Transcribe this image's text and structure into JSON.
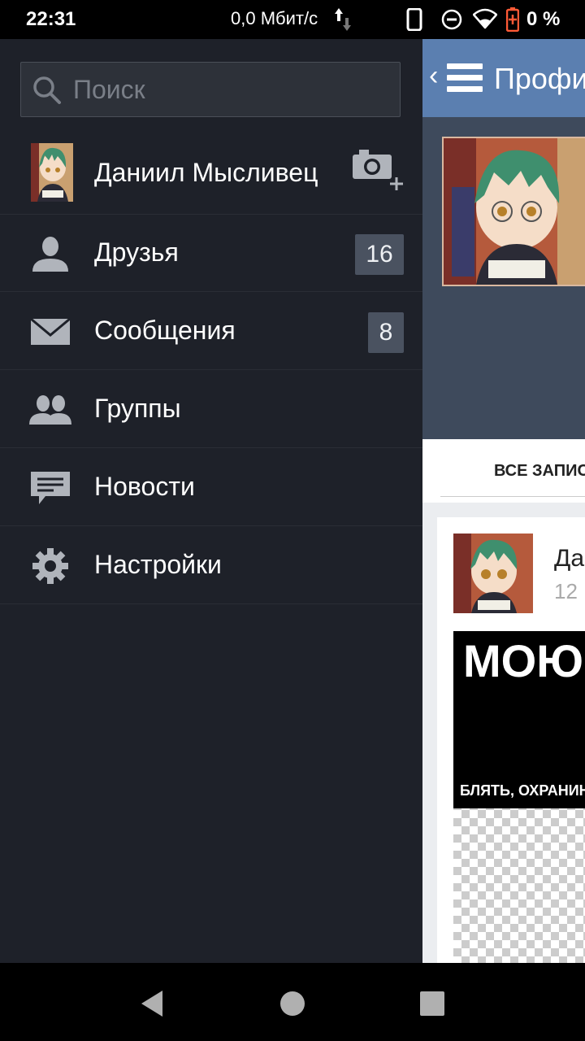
{
  "status_bar": {
    "time": "22:31",
    "network_speed": "0,0 Мбит/с",
    "battery_percent": "0 %"
  },
  "background_app": {
    "back_symbol": "‹",
    "title": "Профиль",
    "tab_label": "ВСЕ ЗАПИСИ",
    "post": {
      "author": "Даниил Мысливец",
      "date": "12",
      "meme_top_text": "МОЮ",
      "meme_bottom_text": "БЛЯТЬ, ОХРАНИНИК"
    }
  },
  "drawer": {
    "search": {
      "placeholder": "Поиск",
      "value": ""
    },
    "profile": {
      "name": "Даниил Мысливец"
    },
    "items": [
      {
        "id": "friends",
        "label": "Друзья",
        "badge": "16",
        "icon": "person-icon"
      },
      {
        "id": "messages",
        "label": "Сообщения",
        "badge": "8",
        "icon": "envelope-icon"
      },
      {
        "id": "groups",
        "label": "Группы",
        "icon": "group-icon"
      },
      {
        "id": "news",
        "label": "Новости",
        "icon": "chat-bubble-icon"
      },
      {
        "id": "settings",
        "label": "Настройки",
        "icon": "gear-icon"
      }
    ]
  },
  "colors": {
    "drawer_bg": "#1e2129",
    "header_blue": "#5b7fb0",
    "badge_bg": "#4a5260",
    "icon_gray": "#b0b4bb"
  }
}
